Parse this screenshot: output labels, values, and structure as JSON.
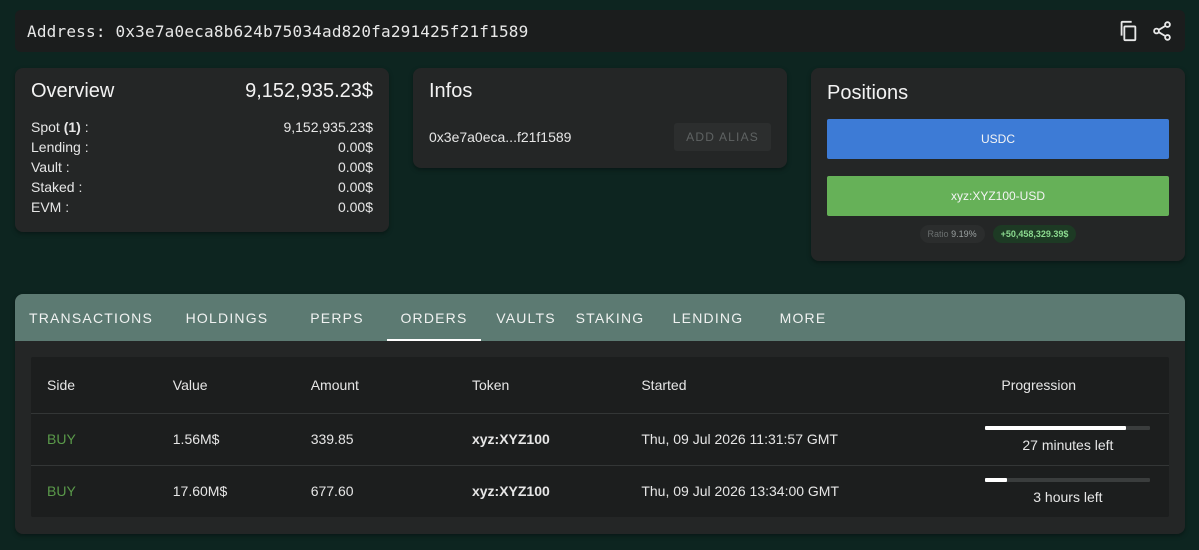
{
  "address": {
    "label": "Address: 0x3e7a0eca8b624b75034ad820fa291425f21f1589"
  },
  "overview": {
    "title": "Overview",
    "total": "9,152,935.23$",
    "rows": [
      {
        "label_pre": "Spot ",
        "label_bold": "(1)",
        "label_post": " :",
        "value": "9,152,935.23$"
      },
      {
        "label_pre": "Lending :",
        "label_bold": "",
        "label_post": "",
        "value": "0.00$"
      },
      {
        "label_pre": "Vault :",
        "label_bold": "",
        "label_post": "",
        "value": "0.00$"
      },
      {
        "label_pre": "Staked :",
        "label_bold": "",
        "label_post": "",
        "value": "0.00$"
      },
      {
        "label_pre": "EVM :",
        "label_bold": "",
        "label_post": "",
        "value": "0.00$"
      }
    ]
  },
  "infos": {
    "title": "Infos",
    "short_address": "0x3e7a0eca...f21f1589",
    "alias_button": "ADD ALIAS"
  },
  "positions": {
    "title": "Positions",
    "items": [
      {
        "label": "USDC",
        "color": "#3d7bd6"
      },
      {
        "label": "xyz:XYZ100-USD",
        "color": "#66b158"
      }
    ],
    "ratio_label": "Ratio",
    "ratio_value": "9.19%",
    "pnl": "+50,458,329.39$"
  },
  "tabs": [
    {
      "label": "TRANSACTIONS",
      "active": false
    },
    {
      "label": "HOLDINGS",
      "active": false
    },
    {
      "label": "PERPS",
      "active": false
    },
    {
      "label": "ORDERS",
      "active": true
    },
    {
      "label": "VAULTS",
      "active": false
    },
    {
      "label": "STAKING",
      "active": false
    },
    {
      "label": "LENDING",
      "active": false
    },
    {
      "label": "MORE",
      "active": false
    }
  ],
  "orders": {
    "columns": [
      "Side",
      "Value",
      "Amount",
      "Token",
      "Started",
      "Progression"
    ],
    "rows": [
      {
        "side": "BUY",
        "value": "1.56M$",
        "amount": "339.85",
        "token": "xyz:XYZ100",
        "started": "Thu, 09 Jul 2026 11:31:57 GMT",
        "progress": 0.85,
        "time_left": "27 minutes left"
      },
      {
        "side": "BUY",
        "value": "17.60M$",
        "amount": "677.60",
        "token": "xyz:XYZ100",
        "started": "Thu, 09 Jul 2026 13:34:00 GMT",
        "progress": 0.13,
        "time_left": "3 hours left"
      }
    ]
  },
  "colors": {
    "background": "#0d2520",
    "card": "#242626",
    "tab_bar": "#5c7a72",
    "buy": "#5a9a4a"
  },
  "icons": [
    "copy-icon",
    "share-icon"
  ]
}
